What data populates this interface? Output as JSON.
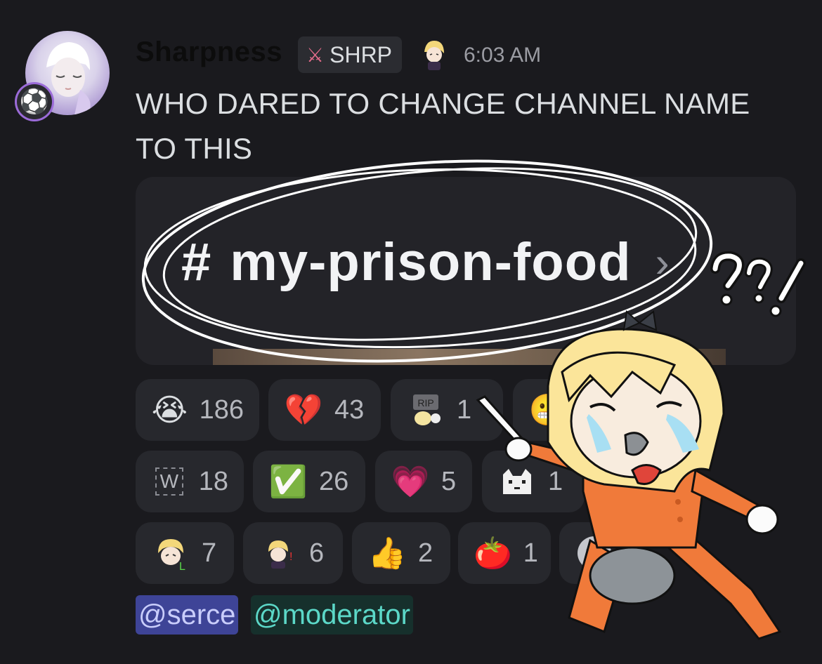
{
  "author": {
    "name": "Sharpness",
    "tag": "SHRP",
    "timestamp": "6:03 AM",
    "avatar_icon": "avatar-anime-character",
    "decoration_icon": "soccer-ball-icon"
  },
  "message": {
    "text": "WHO DARED TO CHANGE CHANNEL NAME TO THIS"
  },
  "embed": {
    "channel_hash": "#",
    "channel_name": "my-prison-food",
    "chevron": "›"
  },
  "reactions": [
    {
      "emoji": "😭",
      "count": "186"
    },
    {
      "emoji": "💔",
      "count": "43"
    },
    {
      "emoji": "RIP",
      "count": "1"
    },
    {
      "emoji": "😬",
      "count": ""
    },
    {
      "emoji": "W",
      "count": "18"
    },
    {
      "emoji": "✅",
      "count": "26"
    },
    {
      "emoji": "💗",
      "count": "5"
    },
    {
      "emoji": "cat-icon",
      "count": "1"
    },
    {
      "emoji": "custom-face-1",
      "count": "7"
    },
    {
      "emoji": "custom-face-2",
      "count": "6"
    },
    {
      "emoji": "👍",
      "count": "2"
    },
    {
      "emoji": "🍅",
      "count": "1"
    }
  ],
  "mentions": {
    "user": "@serce",
    "role": "@moderator"
  },
  "sticker": {
    "exclaim": "?!"
  },
  "colors": {
    "background": "#1a1a1e",
    "reaction_bg": "#27282d",
    "mention_user_bg": "#3e4497",
    "mention_role_text": "#5cd8c8",
    "scribble": "#ffffff",
    "jumpsuit": "#f07a3a"
  }
}
